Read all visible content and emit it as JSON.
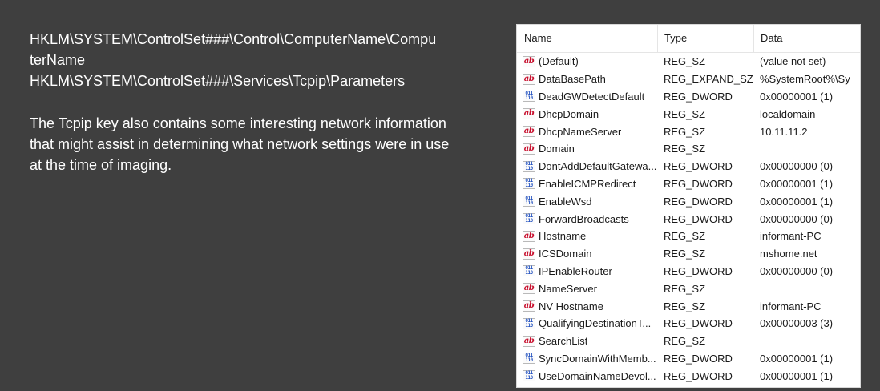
{
  "slide": {
    "line1": "HKLM\\SYSTEM\\ControlSet###\\Control\\ComputerName\\Compu",
    "line2": "terName",
    "line3": "HKLM\\SYSTEM\\ControlSet###\\Services\\Tcpip\\Parameters",
    "paragraph": "The Tcpip key also contains some interesting network information that might assist in determining what network settings were in use at the time of imaging."
  },
  "registry": {
    "headers": {
      "name": "Name",
      "type": "Type",
      "data": "Data"
    },
    "rows": [
      {
        "icon": "string-value-icon",
        "name": "(Default)",
        "type": "REG_SZ",
        "data": "(value not set)"
      },
      {
        "icon": "string-value-icon",
        "name": "DataBasePath",
        "type": "REG_EXPAND_SZ",
        "data": "%SystemRoot%\\Sy"
      },
      {
        "icon": "binary-value-icon",
        "name": "DeadGWDetectDefault",
        "type": "REG_DWORD",
        "data": "0x00000001 (1)"
      },
      {
        "icon": "string-value-icon",
        "name": "DhcpDomain",
        "type": "REG_SZ",
        "data": "localdomain"
      },
      {
        "icon": "string-value-icon",
        "name": "DhcpNameServer",
        "type": "REG_SZ",
        "data": "10.11.11.2"
      },
      {
        "icon": "string-value-icon",
        "name": "Domain",
        "type": "REG_SZ",
        "data": ""
      },
      {
        "icon": "binary-value-icon",
        "name": "DontAddDefaultGatewa...",
        "type": "REG_DWORD",
        "data": "0x00000000 (0)"
      },
      {
        "icon": "binary-value-icon",
        "name": "EnableICMPRedirect",
        "type": "REG_DWORD",
        "data": "0x00000001 (1)"
      },
      {
        "icon": "binary-value-icon",
        "name": "EnableWsd",
        "type": "REG_DWORD",
        "data": "0x00000001 (1)"
      },
      {
        "icon": "binary-value-icon",
        "name": "ForwardBroadcasts",
        "type": "REG_DWORD",
        "data": "0x00000000 (0)"
      },
      {
        "icon": "string-value-icon",
        "name": "Hostname",
        "type": "REG_SZ",
        "data": "informant-PC"
      },
      {
        "icon": "string-value-icon",
        "name": "ICSDomain",
        "type": "REG_SZ",
        "data": "mshome.net"
      },
      {
        "icon": "binary-value-icon",
        "name": "IPEnableRouter",
        "type": "REG_DWORD",
        "data": "0x00000000 (0)"
      },
      {
        "icon": "string-value-icon",
        "name": "NameServer",
        "type": "REG_SZ",
        "data": ""
      },
      {
        "icon": "string-value-icon",
        "name": "NV Hostname",
        "type": "REG_SZ",
        "data": "informant-PC"
      },
      {
        "icon": "binary-value-icon",
        "name": "QualifyingDestinationT...",
        "type": "REG_DWORD",
        "data": "0x00000003 (3)"
      },
      {
        "icon": "string-value-icon",
        "name": "SearchList",
        "type": "REG_SZ",
        "data": ""
      },
      {
        "icon": "binary-value-icon",
        "name": "SyncDomainWithMemb...",
        "type": "REG_DWORD",
        "data": "0x00000001 (1)"
      },
      {
        "icon": "binary-value-icon",
        "name": "UseDomainNameDevol...",
        "type": "REG_DWORD",
        "data": "0x00000001 (1)"
      }
    ]
  }
}
